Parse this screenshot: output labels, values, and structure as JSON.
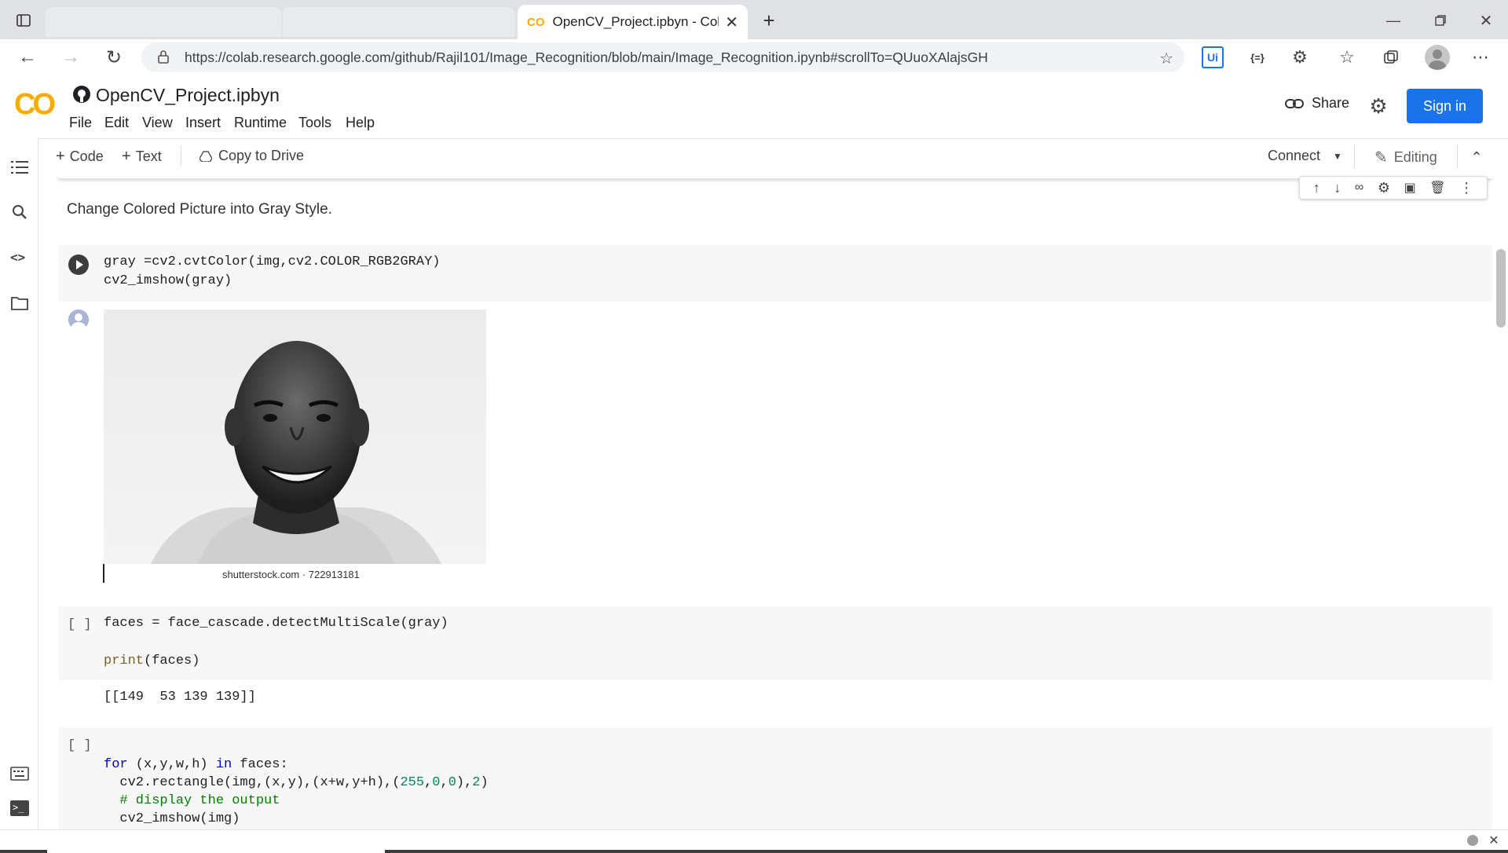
{
  "browser": {
    "active_tab_title": "OpenCV_Project.ipbyn - Colaboratory",
    "url": "https://colab.research.google.com/github/Rajil101/Image_Recognition/blob/main/Image_Recognition.ipynb#scrollTo=QUuoXAlajsGH",
    "extension_label": "Ui",
    "extension_label2": "{=}"
  },
  "header": {
    "logo": "CO",
    "notebook_title": "OpenCV_Project.ipbyn",
    "menu": [
      "File",
      "Edit",
      "View",
      "Insert",
      "Runtime",
      "Tools",
      "Help"
    ],
    "share_label": "Share",
    "signin_label": "Sign in"
  },
  "toolbar": {
    "code_label": "Code",
    "text_label": "Text",
    "copy_label": "Copy to Drive",
    "connect_label": "Connect",
    "editing_label": "Editing"
  },
  "cells": {
    "markdown_text": "Change Colored Picture into Gray Style.",
    "cell1_line1": "gray =cv2.cvtColor(img,cv2.COLOR_RGB2GRAY)",
    "cell1_line2": "cv2_imshow(gray)",
    "image_caption": "shutterstock.com · 722913181",
    "cell2_bracket": "[ ]",
    "cell2_line1": "faces = face_cascade.detectMultiScale(gray)",
    "cell2_line2_fn": "print",
    "cell2_line2_rest": "(faces)",
    "cell2_output": "[[149  53 139 139]]",
    "cell3_bracket": "[ ]",
    "cell3_for": "for",
    "cell3_vars": " (x,y,w,h) ",
    "cell3_in": "in",
    "cell3_faces": " faces:",
    "cell3_rect_a": "  cv2.rectangle(img,(x,y),(x+w,y+h),(",
    "cell3_n255": "255",
    "cell3_c1": ",",
    "cell3_n0a": "0",
    "cell3_c2": ",",
    "cell3_n0b": "0",
    "cell3_c3": "),",
    "cell3_n2": "2",
    "cell3_close": ")",
    "cell3_comment": "  # display the output",
    "cell3_last": "  cv2_imshow(img)"
  },
  "colors": {
    "accent": "#1a73e8",
    "colab_orange": "#f9ab00"
  }
}
